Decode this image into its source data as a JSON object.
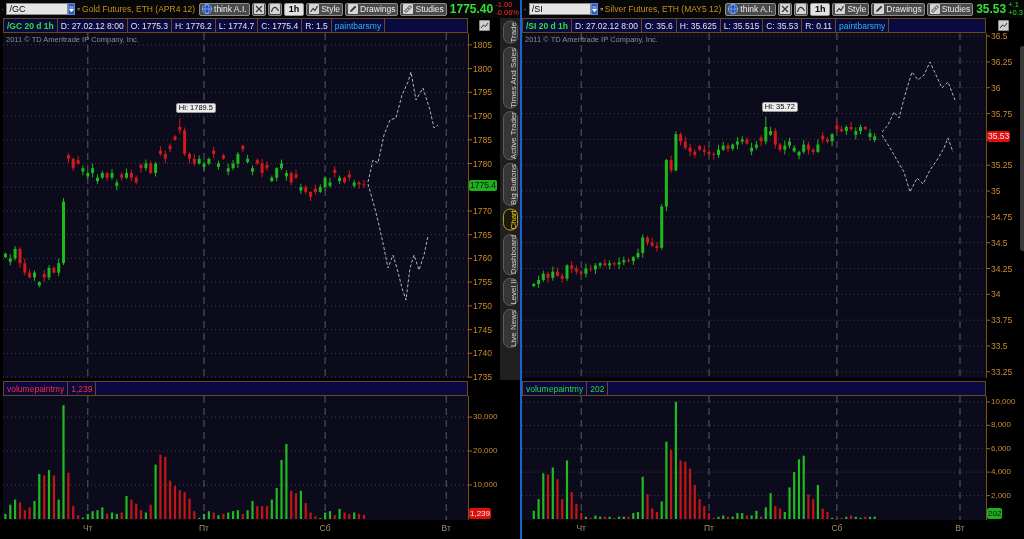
{
  "panels": [
    {
      "toolbar": {
        "symbol": "/GC",
        "description": "Gold Futures, ETH (APR4 12)",
        "buttons": [
          {
            "kind": "ai",
            "label": "think A.I."
          },
          {
            "kind": "cross_tool"
          },
          {
            "kind": "curve_tool"
          },
          {
            "kind": "interval",
            "label": "1h"
          },
          {
            "kind": "style",
            "label": "Style"
          },
          {
            "kind": "drawings",
            "label": "Drawings"
          },
          {
            "kind": "studies",
            "label": "Studies"
          }
        ],
        "last_price": "1775.40",
        "change": "-1.00",
        "change_percent": "-0.06%",
        "change_down": true
      },
      "info_bar": [
        {
          "kind": "symbol",
          "text": "/GC 20 d 1h"
        },
        {
          "kind": "value",
          "text": "D: 27.02.12 8:00"
        },
        {
          "kind": "value",
          "text": "O: 1775.3"
        },
        {
          "kind": "value",
          "text": "H: 1776.2"
        },
        {
          "kind": "value",
          "text": "L: 1774.7"
        },
        {
          "kind": "value",
          "text": "C: 1775.4"
        },
        {
          "kind": "value",
          "text": "R: 1.5"
        },
        {
          "kind": "study",
          "text": "paintbarsmy"
        }
      ],
      "price_chart": {
        "copyright": "2011 © TD Ameritrade IP Company, Inc.",
        "high_label": "Hi: 1789.5",
        "yticks": [
          "1805",
          "1800",
          "1795",
          "1790",
          "1785",
          "1780",
          "1770",
          "1765",
          "1760",
          "1755",
          "1750",
          "1745",
          "1740",
          "1735"
        ],
        "last_price": {
          "label": "1775.4",
          "down": false
        }
      },
      "volume": {
        "study": "volumepaintmy",
        "reading": "1,239",
        "badge": "1,239",
        "down": true,
        "chart_data": {
          "type": "bar",
          "categories": [
            null,
            null,
            null,
            null,
            null,
            null,
            null,
            null,
            null,
            null,
            null,
            null,
            null,
            null,
            null,
            null,
            null,
            "Чт",
            null,
            null,
            null,
            null,
            null,
            null,
            null,
            null,
            null,
            null,
            null,
            null,
            null,
            null,
            null,
            null,
            null,
            null,
            null,
            null,
            null,
            null,
            null,
            "Пт",
            null,
            null,
            null,
            null,
            null,
            null,
            null,
            null,
            null,
            null,
            null,
            null,
            null,
            null,
            null,
            null,
            null,
            null,
            null,
            null,
            null,
            null,
            null,
            null,
            "Сб",
            null,
            null,
            null,
            null,
            null,
            null,
            null,
            null,
            null,
            null,
            null,
            null,
            null,
            null,
            null,
            null,
            null,
            null,
            null,
            null,
            null,
            null,
            null,
            null,
            "Вт",
            null,
            null,
            null,
            null
          ],
          "series": [
            {
              "color": "#22b822",
              "values": [
                1500,
                4200,
                5700,
                null,
                null,
                null,
                5300,
                13200,
                null,
                14400,
                null,
                5700,
                33500,
                null,
                null,
                null,
                400,
                1500,
                2300,
                2600,
                3400,
                null,
                1900,
                1500,
                null,
                6800,
                null,
                null,
                null,
                1900,
                null,
                16000,
                null,
                null,
                null,
                null,
                null,
                null,
                null,
                null,
                300,
                1500,
                2300,
                null,
                1100,
                null,
                1900,
                2300,
                2600,
                null,
                2600,
                5300,
                null,
                null,
                null,
                5700,
                9100,
                17400,
                22100,
                null,
                null,
                8300,
                null,
                null,
                null,
                300,
                1900,
                2300,
                null,
                3000,
                null,
                null,
                1900,
                null,
                null,
                null,
                null,
                null,
                null,
                null,
                null,
                null,
                null,
                null,
                null,
                null,
                null,
                null,
                null,
                null,
                null,
                null,
                null,
                null,
                null,
                null
              ]
            },
            {
              "color": "#c41414",
              "values": [
                null,
                null,
                null,
                4900,
                2600,
                3400,
                null,
                null,
                12800,
                null,
                12800,
                null,
                null,
                13600,
                3800,
                1100,
                null,
                null,
                null,
                null,
                null,
                1500,
                null,
                null,
                1900,
                null,
                5700,
                4500,
                2600,
                null,
                4200,
                null,
                18900,
                18300,
                11300,
                9800,
                8500,
                7900,
                6000,
                2300,
                null,
                null,
                null,
                1900,
                null,
                1500,
                null,
                null,
                null,
                1500,
                null,
                null,
                3800,
                3800,
                3800,
                null,
                null,
                null,
                null,
                8300,
                7600,
                null,
                4700,
                1900,
                800,
                null,
                null,
                null,
                1100,
                null,
                1900,
                1500,
                null,
                1500,
                1200,
                null,
                null,
                null,
                null,
                null,
                null,
                null,
                null,
                null,
                null,
                null,
                null,
                null,
                null,
                null,
                null,
                null,
                null,
                null,
                null,
                null
              ]
            }
          ],
          "ylim": [
            0,
            36200
          ],
          "yticks": [
            {
              "value": 10000,
              "label": "10,000"
            },
            {
              "value": 20000,
              "label": "20,000"
            },
            {
              "value": 30000,
              "label": "30,000"
            }
          ],
          "grid": true
        }
      }
    },
    {
      "toolbar": {
        "symbol": "/SI",
        "description": "Silver Futures, ETH (MAY5 12)",
        "buttons": [
          {
            "kind": "ai",
            "label": "think A.I."
          },
          {
            "kind": "cross_tool"
          },
          {
            "kind": "curve_tool"
          },
          {
            "kind": "interval",
            "label": "1h"
          },
          {
            "kind": "style",
            "label": "Style"
          },
          {
            "kind": "drawings",
            "label": "Drawings"
          },
          {
            "kind": "studies",
            "label": "Studies"
          }
        ],
        "last_price": "35.53",
        "change": "+.1",
        "change_percent": "+0.3",
        "change_down": false
      },
      "info_bar": [
        {
          "kind": "symbol",
          "text": "/SI 20 d 1h"
        },
        {
          "kind": "value",
          "text": "D: 27.02.12 8:00"
        },
        {
          "kind": "value",
          "text": "O: 35.6"
        },
        {
          "kind": "value",
          "text": "H: 35.625"
        },
        {
          "kind": "value",
          "text": "L: 35.515"
        },
        {
          "kind": "value",
          "text": "C: 35.53"
        },
        {
          "kind": "value",
          "text": "R: 0.11"
        },
        {
          "kind": "study",
          "text": "paintbarsmy"
        }
      ],
      "price_chart": {
        "copyright": "2011 © TD Ameritrade IP Company, Inc.",
        "high_label": "Hi: 35.72",
        "yticks": [
          "36.5",
          "36.25",
          "36",
          "35.75",
          "35.25",
          "35",
          "34.75",
          "34.5",
          "34.25",
          "34",
          "33.75",
          "33.5",
          "33.25"
        ],
        "last_price": {
          "label": "35.53",
          "down": true
        }
      },
      "volume": {
        "study": "volumepaintmy",
        "reading": "202",
        "badge": "202",
        "down": false,
        "chart_data": {
          "type": "bar",
          "categories": [
            null,
            null,
            null,
            null,
            null,
            null,
            null,
            null,
            null,
            null,
            null,
            null,
            "Чт",
            null,
            null,
            null,
            null,
            null,
            null,
            null,
            null,
            null,
            null,
            null,
            null,
            null,
            null,
            null,
            null,
            null,
            null,
            null,
            null,
            null,
            null,
            null,
            null,
            null,
            null,
            "Пт",
            null,
            null,
            null,
            null,
            null,
            null,
            null,
            null,
            null,
            null,
            null,
            null,
            null,
            null,
            null,
            null,
            null,
            null,
            null,
            null,
            null,
            null,
            null,
            null,
            null,
            null,
            "Сб",
            null,
            null,
            null,
            null,
            null,
            null,
            null,
            null,
            null,
            null,
            null,
            null,
            null,
            null,
            null,
            null,
            null,
            null,
            null,
            null,
            null,
            null,
            null,
            null,
            null,
            "Вт",
            null,
            null,
            null,
            null,
            null
          ],
          "series": [
            {
              "color": "#22b822",
              "values": [
                null,
                null,
                700,
                1700,
                3900,
                null,
                4400,
                null,
                null,
                5000,
                null,
                null,
                null,
                200,
                null,
                300,
                200,
                null,
                200,
                null,
                200,
                200,
                null,
                500,
                600,
                3600,
                null,
                null,
                null,
                1500,
                6600,
                null,
                10000,
                null,
                null,
                null,
                null,
                null,
                null,
                null,
                null,
                200,
                300,
                null,
                200,
                500,
                500,
                null,
                300,
                700,
                null,
                1000,
                2200,
                null,
                null,
                600,
                2700,
                4000,
                5100,
                5400,
                null,
                null,
                2900,
                null,
                null,
                100,
                null,
                null,
                200,
                null,
                200,
                100,
                null,
                200,
                200,
                null,
                null,
                null,
                null,
                null,
                null,
                null,
                null,
                null,
                null,
                null,
                null,
                null,
                null,
                null,
                null,
                null,
                null,
                null,
                null,
                null,
                null,
                null
              ]
            },
            {
              "color": "#c41414",
              "values": [
                null,
                null,
                null,
                null,
                null,
                3800,
                null,
                3400,
                1700,
                null,
                2300,
                1300,
                500,
                null,
                100,
                null,
                null,
                200,
                null,
                100,
                null,
                null,
                200,
                null,
                null,
                null,
                2100,
                900,
                600,
                null,
                null,
                5900,
                null,
                5000,
                4900,
                4300,
                2900,
                1700,
                1100,
                500,
                100,
                null,
                null,
                200,
                null,
                null,
                null,
                300,
                null,
                null,
                200,
                null,
                null,
                1100,
                900,
                null,
                null,
                null,
                null,
                null,
                2100,
                1700,
                null,
                900,
                600,
                null,
                100,
                100,
                null,
                300,
                null,
                null,
                200,
                null,
                null,
                null,
                null,
                null,
                null,
                null,
                null,
                null,
                null,
                null,
                null,
                null,
                null,
                null,
                null,
                null,
                null,
                null,
                null,
                null,
                null,
                null,
                null,
                null
              ]
            }
          ],
          "ylim": [
            0,
            10500
          ],
          "yticks": [
            {
              "value": 2000,
              "label": "2,000"
            },
            {
              "value": 4000,
              "label": "4,000"
            },
            {
              "value": 6000,
              "label": "6,000"
            },
            {
              "value": 8000,
              "label": "8,000"
            },
            {
              "value": 10000,
              "label": "10,000"
            }
          ],
          "grid": true
        }
      }
    }
  ],
  "side_tabs": [
    {
      "label": "Trade",
      "selected": false
    },
    {
      "label": "Times And Sales",
      "selected": false
    },
    {
      "label": "Active Trader",
      "selected": false
    },
    {
      "label": "Big Buttons",
      "selected": false
    },
    {
      "label": "Chart",
      "selected": true
    },
    {
      "label": "Dashboard",
      "selected": false
    },
    {
      "label": "Level II",
      "selected": false
    },
    {
      "label": "Live News",
      "selected": false
    }
  ]
}
